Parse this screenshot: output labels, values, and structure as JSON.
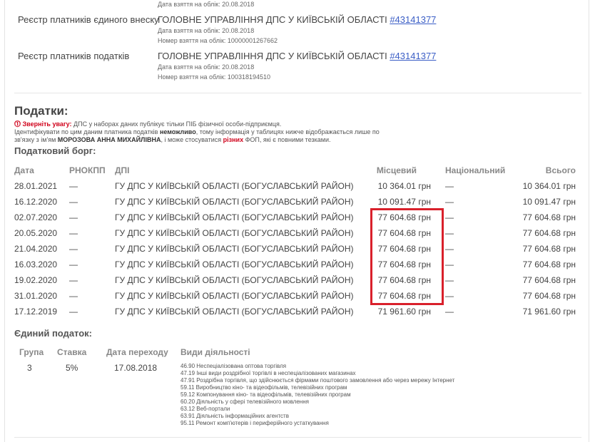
{
  "registry": {
    "top_date": "Дата взяття на облік: 20.08.2018",
    "rows": [
      {
        "label": "Реєстр платників єдиного внеску",
        "authority": "ГОЛОВНЕ УПРАВЛІННЯ ДПС У КИЇВСЬКІЙ ОБЛАСТІ",
        "code": "#43141377",
        "date": "Дата взяття на облік: 20.08.2018",
        "number": "Номер взяття на облік: 10000001267662"
      },
      {
        "label": "Реєстр платників податків",
        "authority": "ГОЛОВНЕ УПРАВЛІННЯ ДПС У КИЇВСЬКІЙ ОБЛАСТІ",
        "code": "#43141377",
        "date": "Дата взяття на облік: 20.08.2018",
        "number": "Номер взяття на облік: 100318194510"
      }
    ]
  },
  "taxes": {
    "title": "Податки:",
    "notice_icon": "⓵",
    "notice_label": "Зверніть увагу:",
    "notice_text": " ДПС у наборах даних публікує тільки ПІБ фізичної особи-підприємця.",
    "notice2_a": "Ідентифікувати по цим даним платника податків ",
    "notice2_b": "неможливо",
    "notice2_c": ", тому інформація у таблицях нижче відображається лише по зв'язку з ім'ям ",
    "notice2_name": "МОРОЗОВА АННА МИХАЙЛІВНА",
    "notice2_d": ", і може стосуватися ",
    "notice2_red": "різних",
    "notice2_e": " ФОП, які є повними тезками."
  },
  "debt": {
    "title": "Податковий борг:",
    "headers": {
      "date": "Дата",
      "rnokpp": "РНОКПП",
      "dpi": "ДПІ",
      "local": "Місцевий",
      "national": "Національний",
      "total": "Всього"
    },
    "rows": [
      {
        "date": "28.01.2021",
        "rnokpp": "—",
        "dpi": "ГУ ДПС У КИЇВСЬКІЙ ОБЛАСТІ (БОГУСЛАВСЬКИЙ РАЙОН)",
        "local": "10 364.01 грн",
        "national": "—",
        "total": "10 364.01 грн"
      },
      {
        "date": "16.12.2020",
        "rnokpp": "—",
        "dpi": "ГУ ДПС У КИЇВСЬКІЙ ОБЛАСТІ (БОГУСЛАВСЬКИЙ РАЙОН)",
        "local": "10 091.47 грн",
        "national": "—",
        "total": "10 091.47 грн"
      },
      {
        "date": "02.07.2020",
        "rnokpp": "—",
        "dpi": "ГУ ДПС У КИЇВСЬКІЙ ОБЛАСТІ (БОГУСЛАВСЬКИЙ РАЙОН)",
        "local": "77 604.68 грн",
        "national": "—",
        "total": "77 604.68 грн"
      },
      {
        "date": "20.05.2020",
        "rnokpp": "—",
        "dpi": "ГУ ДПС У КИЇВСЬКІЙ ОБЛАСТІ (БОГУСЛАВСЬКИЙ РАЙОН)",
        "local": "77 604.68 грн",
        "national": "—",
        "total": "77 604.68 грн"
      },
      {
        "date": "21.04.2020",
        "rnokpp": "—",
        "dpi": "ГУ ДПС У КИЇВСЬКІЙ ОБЛАСТІ (БОГУСЛАВСЬКИЙ РАЙОН)",
        "local": "77 604.68 грн",
        "national": "—",
        "total": "77 604.68 грн"
      },
      {
        "date": "16.03.2020",
        "rnokpp": "—",
        "dpi": "ГУ ДПС У КИЇВСЬКІЙ ОБЛАСТІ (БОГУСЛАВСЬКИЙ РАЙОН)",
        "local": "77 604.68 грн",
        "national": "—",
        "total": "77 604.68 грн"
      },
      {
        "date": "19.02.2020",
        "rnokpp": "—",
        "dpi": "ГУ ДПС У КИЇВСЬКІЙ ОБЛАСТІ (БОГУСЛАВСЬКИЙ РАЙОН)",
        "local": "77 604.68 грн",
        "national": "—",
        "total": "77 604.68 грн"
      },
      {
        "date": "31.01.2020",
        "rnokpp": "—",
        "dpi": "ГУ ДПС У КИЇВСЬКІЙ ОБЛАСТІ (БОГУСЛАВСЬКИЙ РАЙОН)",
        "local": "77 604.68 грн",
        "national": "—",
        "total": "77 604.68 грн"
      },
      {
        "date": "17.12.2019",
        "rnokpp": "—",
        "dpi": "ГУ ДПС У КИЇВСЬКІЙ ОБЛАСТІ (БОГУСЛАВСЬКИЙ РАЙОН)",
        "local": "71 961.60 грн",
        "national": "—",
        "total": "71 961.60 грн"
      }
    ],
    "highlight_color": "#d9202b"
  },
  "single_tax": {
    "title": "Єдиний податок:",
    "headers": {
      "group": "Група",
      "rate": "Ставка",
      "transition_date": "Дата переходу",
      "activities": "Види діяльності"
    },
    "group": "3",
    "rate": "5%",
    "transition_date": "17.08.2018",
    "activities": [
      "46.90 Неспеціалізована оптова торгівля",
      "47.19 Інші види роздрібної торгівлі в неспеціалізованих магазинах",
      "47.91 Роздрібна торгівля, що здійснюється фірмами поштового замовлення або через мережу Інтернет",
      "59.11 Виробництво кіно- та відеофільмів, телевізійних програм",
      "59.12 Компонування кіно- та відеофільмів, телевізійних програм",
      "60.20 Діяльність у сфері телевізійного мовлення",
      "63.12 Веб-портали",
      "63.91 Діяльність інформаційних агентств",
      "95.11 Ремонт комп'ютерів і периферійного устаткування"
    ]
  }
}
